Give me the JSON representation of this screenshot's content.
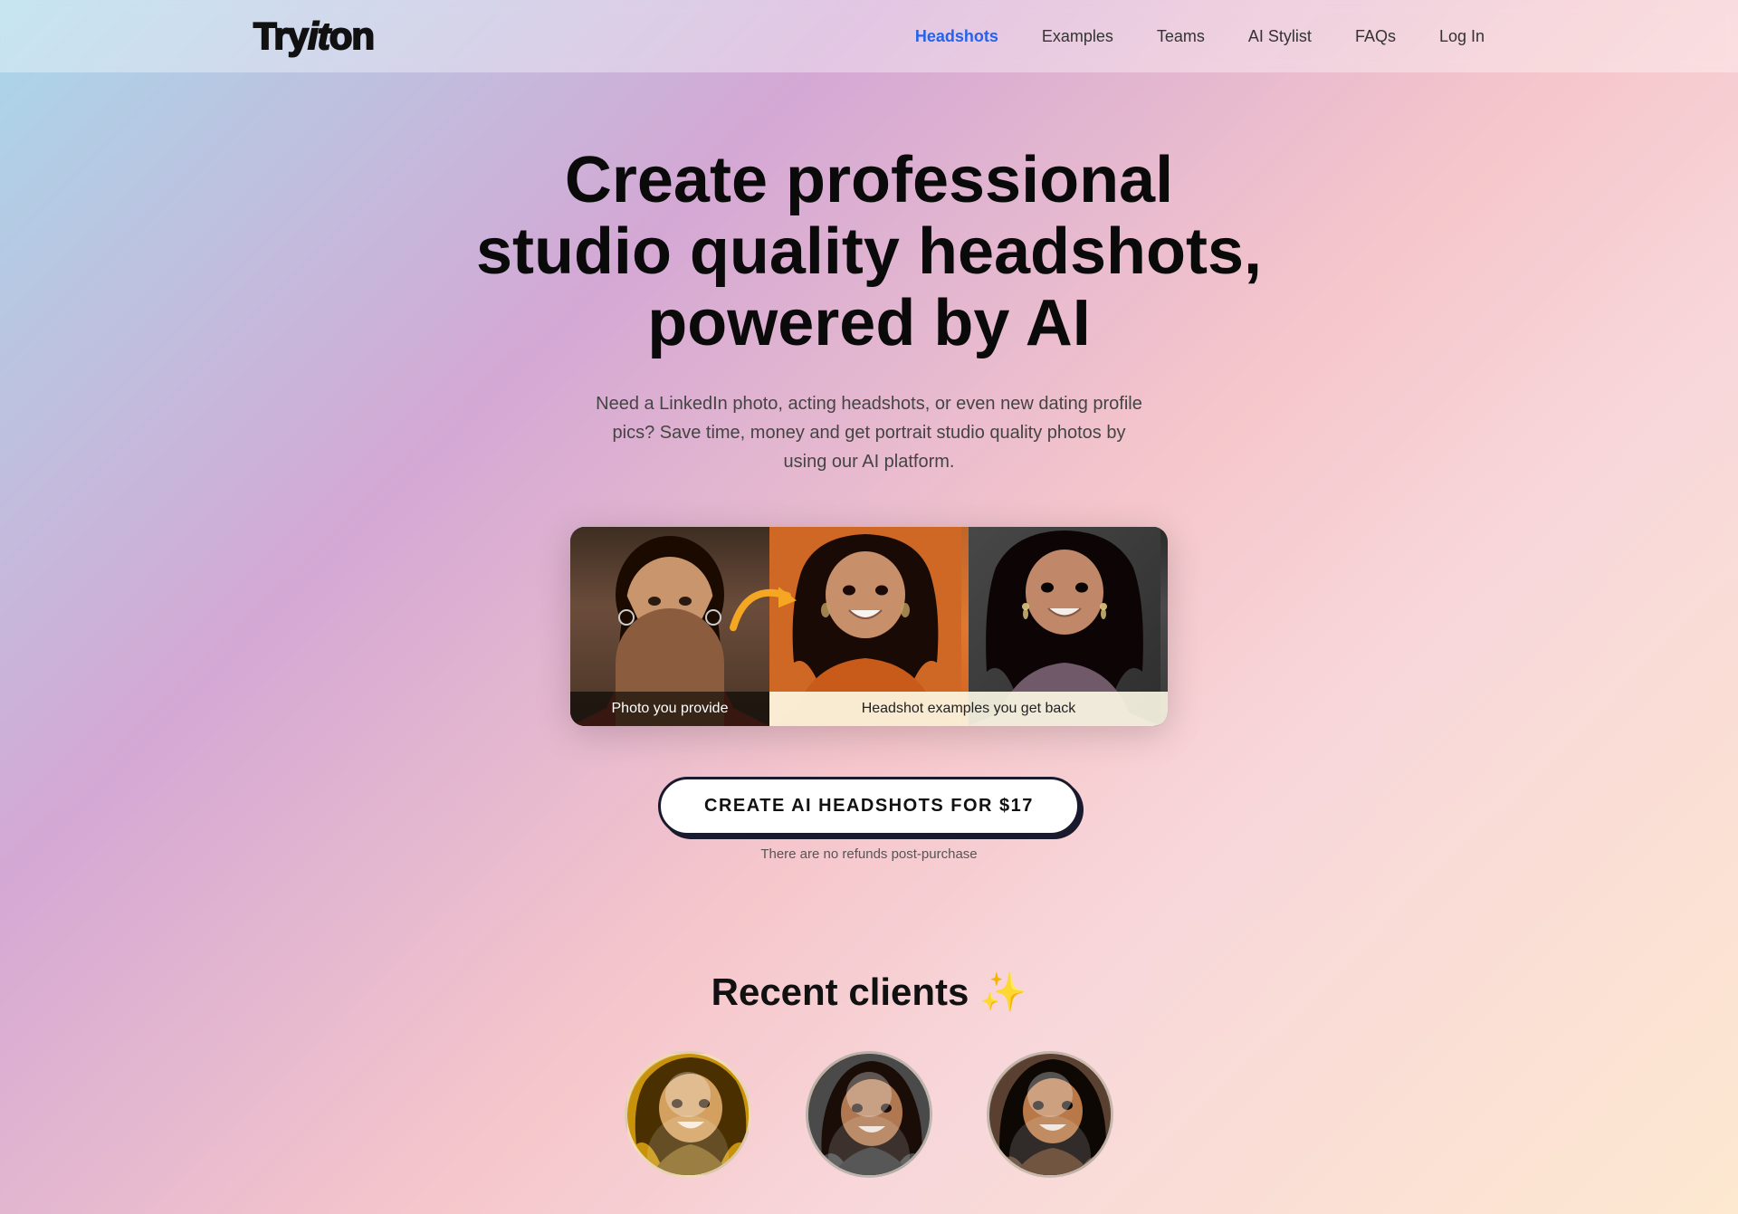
{
  "nav": {
    "logo": "Try it on",
    "links": [
      {
        "label": "Headshots",
        "active": true,
        "id": "headshots"
      },
      {
        "label": "Examples",
        "active": false,
        "id": "examples"
      },
      {
        "label": "Teams",
        "active": false,
        "id": "teams"
      },
      {
        "label": "AI Stylist",
        "active": false,
        "id": "ai-stylist"
      },
      {
        "label": "FAQs",
        "active": false,
        "id": "faqs"
      },
      {
        "label": "Log In",
        "active": false,
        "id": "login"
      }
    ]
  },
  "hero": {
    "title": "Create professional studio quality headshots, powered by AI",
    "subtitle": "Need a LinkedIn photo, acting headshots, or even new dating profile pics? Save time, money and get portrait studio quality photos by using our AI platform.",
    "demo": {
      "before_label": "Photo you provide",
      "after_label": "Headshot examples you get back"
    },
    "cta": {
      "button_label": "CREATE AI HEADSHOTS FOR $17",
      "note": "There are no refunds post-purchase"
    }
  },
  "recent_clients": {
    "title": "Recent clients",
    "sparkle": "✨"
  }
}
